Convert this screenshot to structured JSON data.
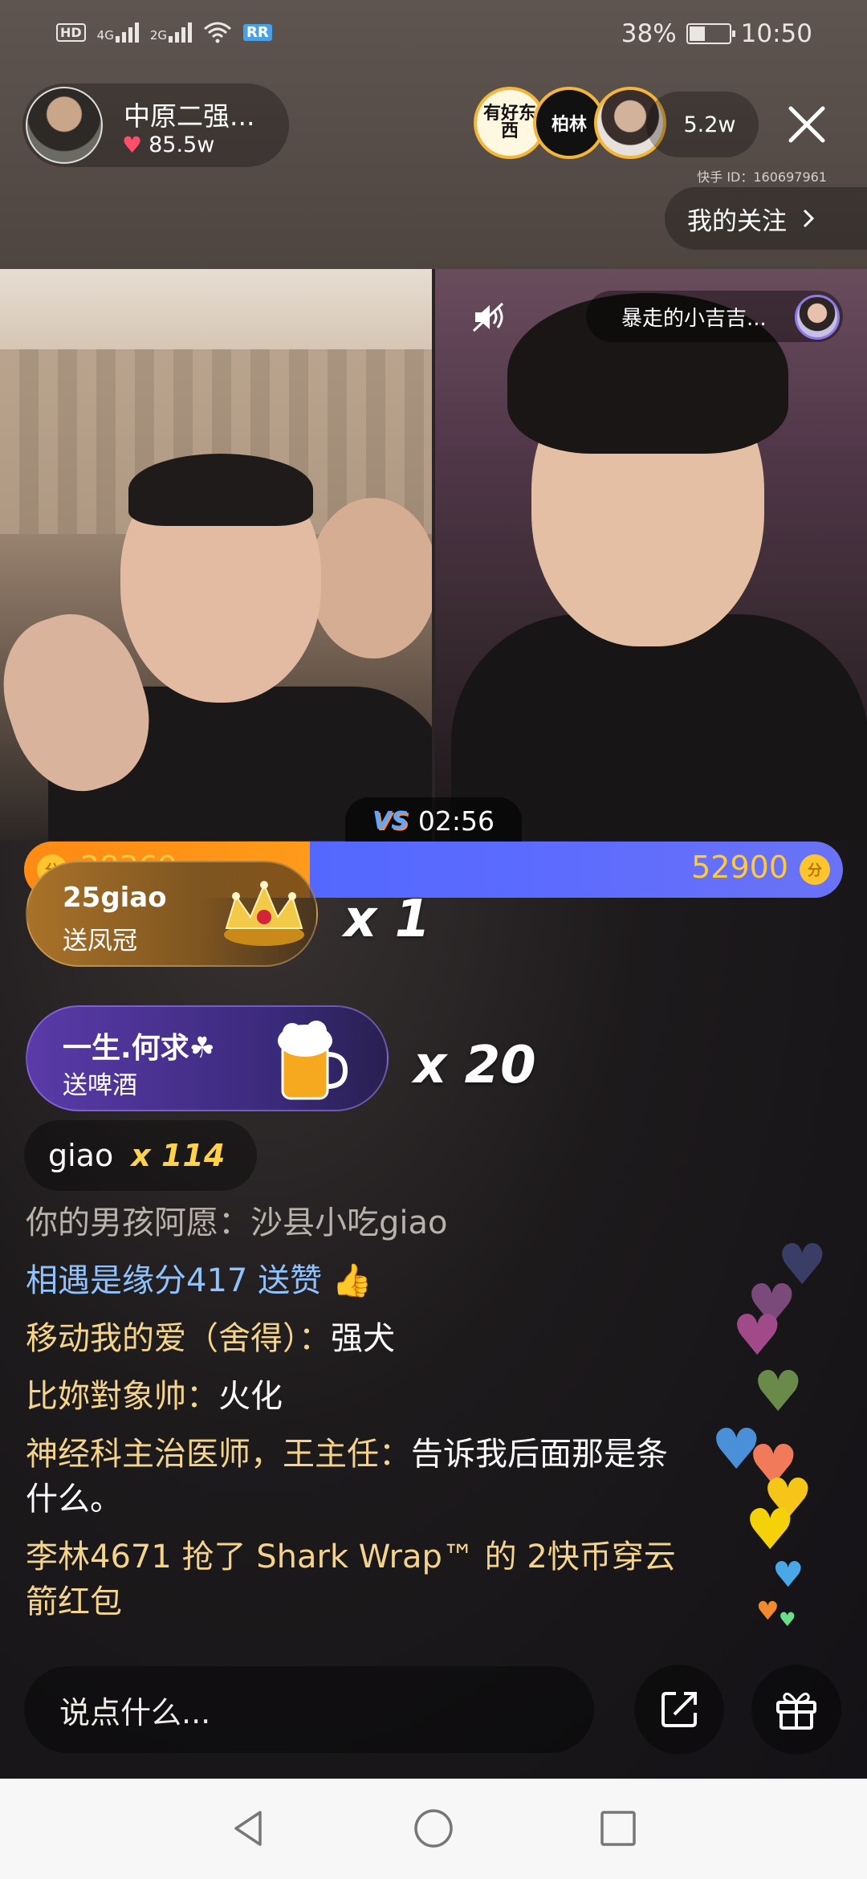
{
  "status_bar": {
    "network_hd": "HD",
    "sim1": "4G",
    "sim2": "2G",
    "badge": "RR",
    "battery": "38%",
    "battery_level_pct": 38,
    "time": "10:50"
  },
  "host": {
    "name": "中原二强...",
    "likes": "85.5w"
  },
  "viewers": {
    "avatar1_text": "有好东西",
    "avatar2_text": "柏林",
    "count": "5.2w"
  },
  "kuaishou_id": "快手 ID：160697961",
  "follow_label": "我的关注",
  "guest_name": "暴走的小吉吉...",
  "pk": {
    "timer": "02:56",
    "left_score": "28369",
    "right_score": "52900",
    "left_share": 0.349,
    "coin_label": "分",
    "colors": {
      "left": "#ff8a14",
      "right": "#5566ff",
      "score": "#ffc93b"
    }
  },
  "gifts": [
    {
      "user": "25giao",
      "action": "送凤冠",
      "multiplier": "x 1",
      "icon": "crown-icon"
    },
    {
      "user": "一生.何求☘",
      "action": "送啤酒",
      "multiplier": "x 20",
      "icon": "beer-icon"
    }
  ],
  "combo": {
    "user": "giao",
    "count": "x 114"
  },
  "comments": [
    {
      "user": "你的男孩阿愿：",
      "text": "沙县小吃giao",
      "style": "faded"
    },
    {
      "user": "相遇是缘分417",
      "text": " 送赞 👍",
      "style": "like"
    },
    {
      "user": "移动我的爱（舍得）：",
      "text": "强犬",
      "style": "normal"
    },
    {
      "user": "比妳對象帅：",
      "text": "火化",
      "style": "normal"
    },
    {
      "user": "神经科主治医师，王主任：",
      "text": "告诉我后面那是条什么。",
      "style": "normal"
    },
    {
      "user": "李林4671 抢了 Shark Wrap™ 的 2快币穿云箭红包",
      "text": "",
      "style": "pkt"
    }
  ],
  "input": {
    "placeholder": "说点什么..."
  }
}
